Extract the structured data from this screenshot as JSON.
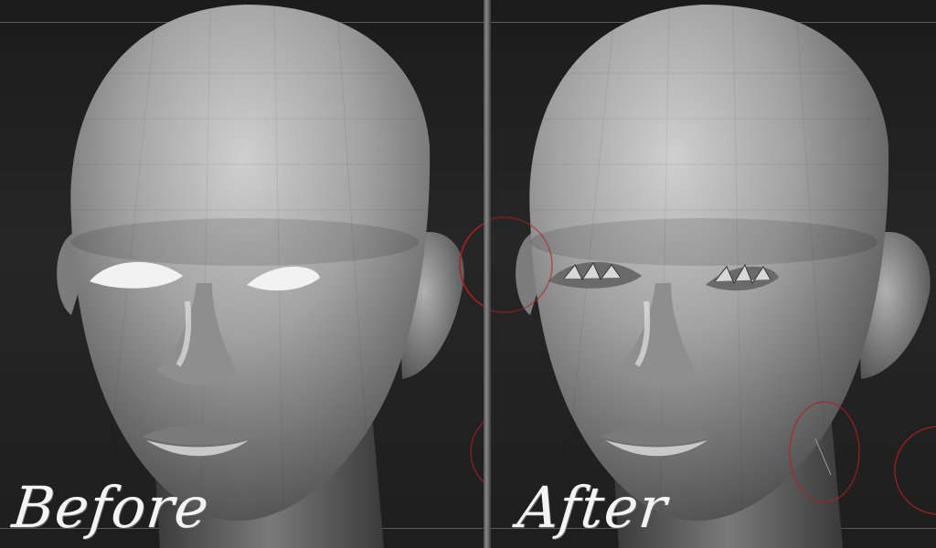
{
  "labels": {
    "before": "Before",
    "after": "After"
  },
  "colors": {
    "background": "#1e1e1e",
    "skin": "#9a9a9a",
    "divider": "#8a8a8a",
    "brush_circle": "#b21e1e"
  }
}
